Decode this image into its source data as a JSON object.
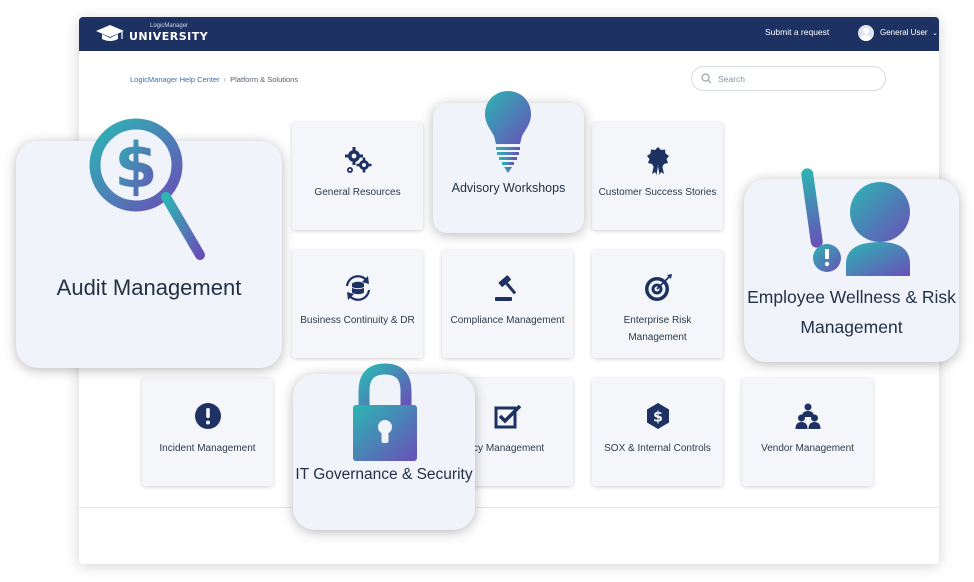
{
  "header": {
    "logo_small": "LogicManager",
    "logo_big": "UNIVERSITY",
    "submit_request": "Submit a request",
    "user_name": "General User"
  },
  "breadcrumb": {
    "home": "LogicManager Help Center",
    "separator": "›",
    "current": "Platform & Solutions"
  },
  "search": {
    "placeholder": "Search"
  },
  "tiles": [
    {
      "label": "General Resources",
      "icon": "gears-icon"
    },
    {
      "label": "Customer Success Stories",
      "icon": "award-ribbon-icon"
    },
    {
      "label": "Business Continuity & DR",
      "icon": "sync-database-icon"
    },
    {
      "label": "Compliance Management",
      "icon": "gavel-icon"
    },
    {
      "label": "Enterprise Risk Management",
      "icon": "target-icon"
    },
    {
      "label": "Incident Management",
      "icon": "exclamation-circle-icon"
    },
    {
      "label": "icy Management",
      "icon": "checkbox-icon"
    },
    {
      "label": "SOX & Internal Controls",
      "icon": "dollar-shield-icon"
    },
    {
      "label": "Vendor Management",
      "icon": "people-group-icon"
    }
  ],
  "highlights": {
    "advisory": "Advisory Workshops",
    "audit": "Audit Management",
    "wellness": "Employee Wellness & Risk Management",
    "itgov": "IT Governance & Security"
  },
  "colors": {
    "header_bg": "#1d3163",
    "icon_navy": "#1d3163",
    "gradient_teal": "#2bb6b3",
    "gradient_purple": "#6a4fb8"
  }
}
